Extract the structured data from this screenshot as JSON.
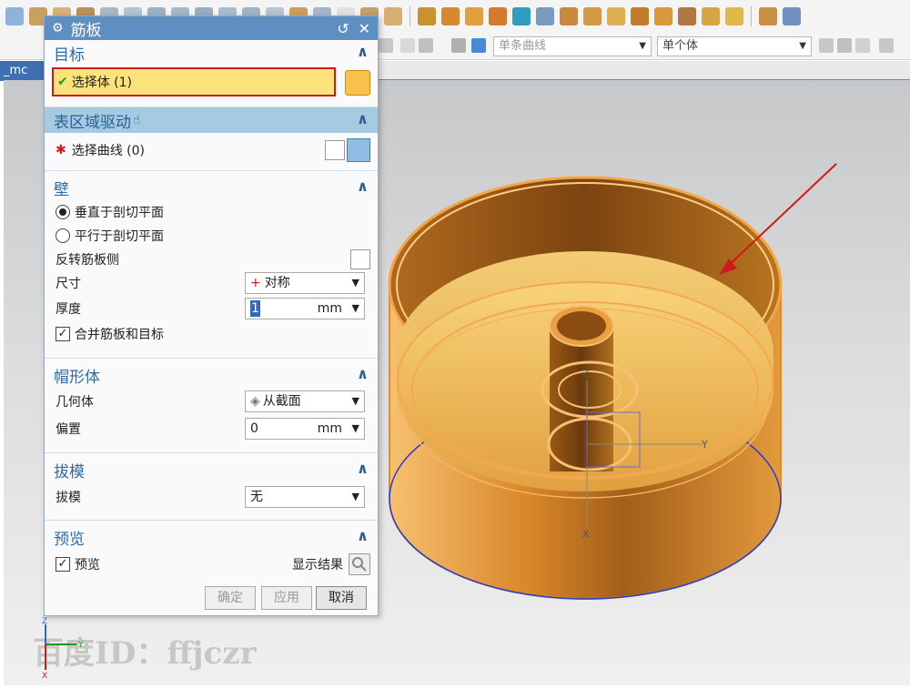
{
  "toolbar": {
    "curve_filter": "单条曲线",
    "body_filter": "单个体",
    "file_tab": "_mc"
  },
  "dialog": {
    "title": "筋板",
    "sections": {
      "target": {
        "title": "目标",
        "select_body": "选择体 (1)"
      },
      "region": {
        "title": "表区域驱动",
        "select_curve": "选择曲线 (0)"
      },
      "wall": {
        "title": "壁",
        "perp": "垂直于剖切平面",
        "parallel": "平行于剖切平面",
        "reverse": "反转筋板侧",
        "size_label": "尺寸",
        "size_value": "对称",
        "thickness_label": "厚度",
        "thickness_value": "1",
        "thickness_unit": "mm",
        "combine": "合并筋板和目标"
      },
      "cap": {
        "title": "帽形体",
        "geometry_label": "几何体",
        "geometry_value": "从截面",
        "offset_label": "偏置",
        "offset_value": "0",
        "offset_unit": "mm"
      },
      "draft": {
        "title": "拔模",
        "draft_label": "拔模",
        "draft_value": "无"
      },
      "preview": {
        "title": "预览",
        "preview_label": "预览",
        "show_result": "显示结果"
      }
    },
    "buttons": {
      "ok": "确定",
      "apply": "应用",
      "cancel": "取消"
    }
  },
  "watermark": "百度ID：ffjczr",
  "axes": {
    "z": "Z",
    "y": "Y",
    "x": "X"
  },
  "colors": {
    "title_bar": "#5d8fc2",
    "section_text": "#2c6aa8",
    "highlight_yellow": "#fbe27a",
    "highlight_border": "#d01a1a",
    "model_orange": "#f2b04a"
  }
}
